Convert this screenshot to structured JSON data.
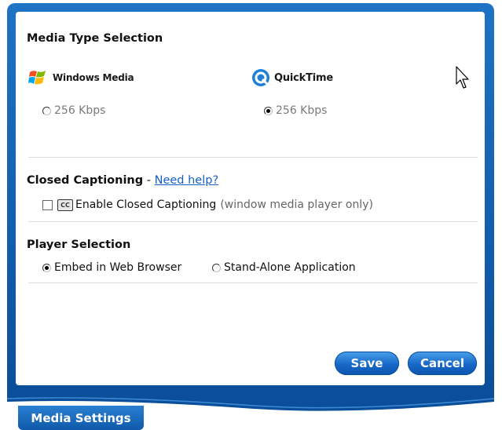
{
  "media_type": {
    "title": "Media Type Selection",
    "windows_media": {
      "name": "Windows Media",
      "bitrate": "256 Kbps",
      "selected": false
    },
    "quicktime": {
      "name": "QuickTime",
      "bitrate": "256 Kbps",
      "selected": true
    }
  },
  "closed_captioning": {
    "title": "Closed Captioning",
    "separator": " - ",
    "help_link": "Need help?",
    "cc_icon_text": "CC",
    "checkbox_label": "Enable Closed Captioning",
    "checkbox_note": "(window media player only)",
    "checked": false
  },
  "player_selection": {
    "title": "Player Selection",
    "options": [
      {
        "label": "Embed in Web Browser",
        "selected": true
      },
      {
        "label": "Stand-Alone Application",
        "selected": false
      }
    ]
  },
  "buttons": {
    "save": "Save",
    "cancel": "Cancel"
  },
  "tab_label": "Media Settings",
  "colors": {
    "frame_blue": "#0b4f9a",
    "link_blue": "#1560c4",
    "button_blue": "#1668c8"
  },
  "icons": [
    "windows-media-logo-icon",
    "quicktime-logo-icon",
    "closed-caption-icon",
    "mouse-cursor-icon"
  ]
}
